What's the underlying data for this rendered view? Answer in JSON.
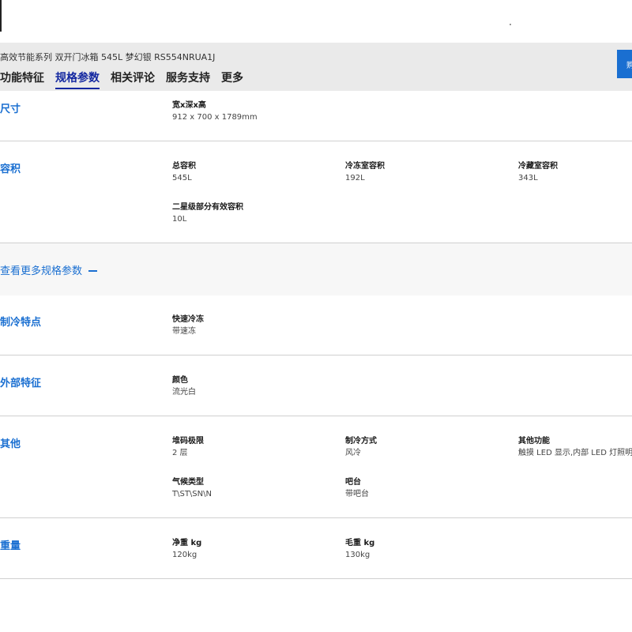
{
  "header": {
    "product_title": "高效节能系列 双开门冰箱 545L 梦幻银 RS554NRUA1J",
    "tabs": [
      {
        "label": "功能特征"
      },
      {
        "label": "规格参数"
      },
      {
        "label": "相关评论"
      },
      {
        "label": "服务支持"
      },
      {
        "label": "更多"
      }
    ],
    "cta_label": "购"
  },
  "sections": {
    "size": {
      "label": "尺寸",
      "items": [
        {
          "name": "宽x深x高",
          "value": "912 x 700 x 1789mm"
        }
      ]
    },
    "capacity": {
      "label": "容积",
      "items": [
        {
          "name": "总容积",
          "value": "545L"
        },
        {
          "name": "冷冻室容积",
          "value": "192L"
        },
        {
          "name": "冷藏室容积",
          "value": "343L"
        },
        {
          "name": "二星级部分有效容积",
          "value": "10L"
        }
      ]
    },
    "more": {
      "label": "查看更多规格参数"
    },
    "cooling": {
      "label": "制冷特点",
      "items": [
        {
          "name": "快速冷冻",
          "value": "带速冻"
        }
      ]
    },
    "exterior": {
      "label": "外部特征",
      "items": [
        {
          "name": "颜色",
          "value": "流光白"
        }
      ]
    },
    "other": {
      "label": "其他",
      "items": [
        {
          "name": "堆码极限",
          "value": "2 层"
        },
        {
          "name": "制冷方式",
          "value": "风冷"
        },
        {
          "name": "其他功能",
          "value": "触摸 LED 显示,内部 LED 灯照明"
        },
        {
          "name": "气候类型",
          "value": "T\\ST\\SN\\N"
        },
        {
          "name": "吧台",
          "value": "带吧台"
        }
      ]
    },
    "weight": {
      "label": "重量",
      "items": [
        {
          "name": "净重 kg",
          "value": "120kg"
        },
        {
          "name": "毛重 kg",
          "value": "130kg"
        }
      ]
    }
  }
}
